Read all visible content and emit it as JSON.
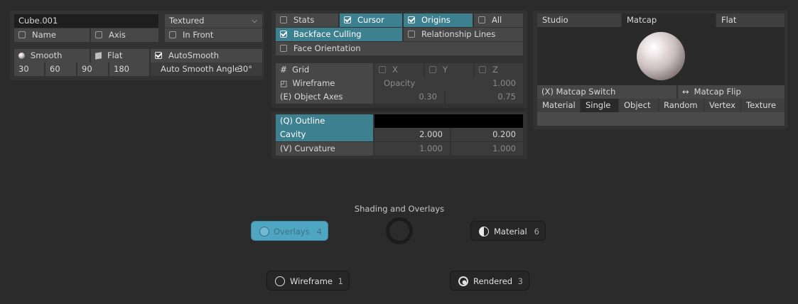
{
  "object_panel": {
    "object_name": "Cube.001",
    "shading_mode": "Textured",
    "name_label": "Name",
    "axis_label": "Axis",
    "in_front_label": "In Front",
    "smooth_label": "Smooth",
    "flat_label": "Flat",
    "autosmooth_label": "AutoSmooth",
    "angles": [
      "30",
      "60",
      "90",
      "180"
    ],
    "autosmooth_angle_label": "Auto Smooth Angle",
    "autosmooth_angle_value": "30°"
  },
  "overlay_panel": {
    "stats_label": "Stats",
    "cursor_label": "Cursor",
    "origins_label": "Origins",
    "all_label": "All",
    "backface_label": "Backface Culling",
    "relationship_label": "Relationship Lines",
    "face_orientation_label": "Face Orientation",
    "grid_label": "Grid",
    "x_label": "X",
    "y_label": "Y",
    "z_label": "Z",
    "wireframe_label": "Wireframe",
    "opacity_label": "Opacity",
    "opacity_value": "1.000",
    "object_axes_label": "(E) Object Axes",
    "axes_value_1": "0.30",
    "axes_value_2": "0.75"
  },
  "outline_panel": {
    "outline_label": "(Q) Outline",
    "cavity_label": "Cavity",
    "cavity_value_1": "2.000",
    "cavity_value_2": "0.200",
    "curvature_label": "(V) Curvature",
    "curvature_value_1": "1.000",
    "curvature_value_2": "1.000"
  },
  "matcap_panel": {
    "tabs": [
      "Studio",
      "Matcap",
      "Flat"
    ],
    "matcap_switch_label": "(X) Matcap Switch",
    "matcap_flip_label": "Matcap Flip",
    "color_tabs": [
      "Material",
      "Single",
      "Object",
      "Random",
      "Vertex",
      "Texture"
    ]
  },
  "pie_menu": {
    "title": "Shading and Overlays",
    "overlays_label": "Overlays",
    "overlays_key": "4",
    "material_label": "Material",
    "material_key": "6",
    "wireframe_label": "Wireframe",
    "wireframe_key": "1",
    "rendered_label": "Rendered",
    "rendered_key": "3"
  },
  "colors": {
    "background": "#2b2b2b",
    "panel": "#323232",
    "accent": "#3d8090",
    "overlays_button": "#4fa6c2"
  }
}
